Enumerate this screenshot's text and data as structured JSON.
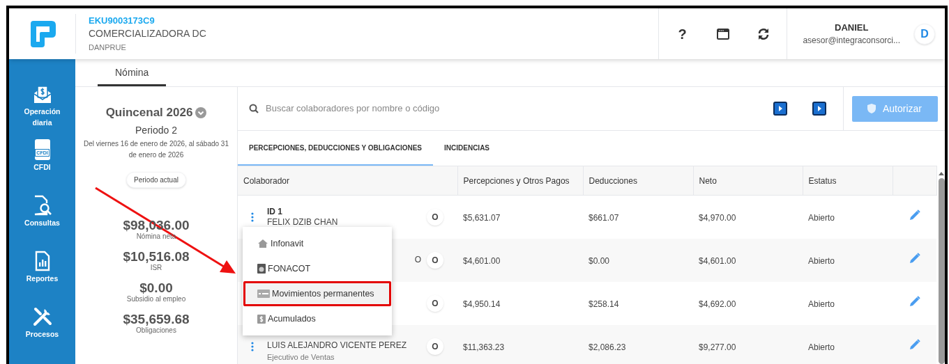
{
  "company": {
    "rfc": "EKU9003173C9",
    "name": "COMERCIALIZADORA DC",
    "code": "DANPRUE"
  },
  "toolbar": [
    {
      "kind": "help",
      "label": "?"
    },
    {
      "kind": "window"
    },
    {
      "kind": "refresh"
    }
  ],
  "user": {
    "name": "DANIEL",
    "email": "asesor@integraconsorci...",
    "initial": "D"
  },
  "sidebar": {
    "items": [
      {
        "kind": "money",
        "label": "Operación diaria"
      },
      {
        "kind": "cfdi",
        "label": "CFDI",
        "icon_text": "CFDI"
      },
      {
        "kind": "search",
        "label": "Consultas"
      },
      {
        "kind": "report",
        "label": "Reportes"
      },
      {
        "kind": "tools",
        "label": "Procesos"
      }
    ]
  },
  "top_tabs": [
    {
      "label": "Nómina",
      "selected": true
    }
  ],
  "period": {
    "title": "Quincenal 2026",
    "number": "Periodo 2",
    "range": "Del viernes 16 de enero de 2026, al sábado 31 de enero de 2026",
    "badge": "Periodo actual"
  },
  "totals": [
    {
      "amount": "$98,036.00",
      "label": "Nómina neta"
    },
    {
      "amount": "$10,516.08",
      "label": "ISR"
    },
    {
      "amount": "$0.00",
      "label": "Subsidio al empleo"
    },
    {
      "amount": "$35,659.68",
      "label": "Obligaciones"
    }
  ],
  "search": {
    "placeholder": "Buscar colaboradores por nombre o código"
  },
  "authorize_button": {
    "label": "Autorizar",
    "disabled": true
  },
  "tabs": [
    {
      "label": "PERCEPCIONES, DEDUCCIONES Y OBLIGACIONES",
      "selected": true
    },
    {
      "label": "INCIDENCIAS",
      "selected": false
    }
  ],
  "table": {
    "columns": [
      "Colaborador",
      "Percepciones y Otros Pagos",
      "Deducciones",
      "Neto",
      "Estatus"
    ],
    "rows": [
      {
        "id": "ID 1",
        "name": "FELIX DZIB CHAN",
        "badge": "O",
        "perceptions": "$5,631.07",
        "deductions": "$661.07",
        "net": "$4,970.00",
        "status": "Abierto"
      },
      {
        "name_tail": "O",
        "badge": "O",
        "perceptions": "$4,601.00",
        "deductions": "$0.00",
        "net": "$4,601.00",
        "status": "Abierto"
      },
      {
        "badge": "O",
        "perceptions": "$4,950.14",
        "deductions": "$258.14",
        "net": "$4,692.00",
        "status": "Abierto"
      },
      {
        "name": "LUIS ALEJANDRO VICENTE PEREZ",
        "role": "Ejecutivo de Ventas",
        "badge": "O",
        "perceptions": "$11,363.23",
        "deductions": "$2,086.23",
        "net": "$9,277.00",
        "status": "Abierto"
      }
    ]
  },
  "context_menu": {
    "items": [
      {
        "kind": "house",
        "label": "Infonavit",
        "highlighted": false
      },
      {
        "kind": "card",
        "label": "FONACOT",
        "highlighted": false
      },
      {
        "kind": "list",
        "label": "Movimientos permanentes",
        "highlighted": true
      },
      {
        "kind": "dollar",
        "label": "Acumulados",
        "highlighted": false
      }
    ]
  }
}
